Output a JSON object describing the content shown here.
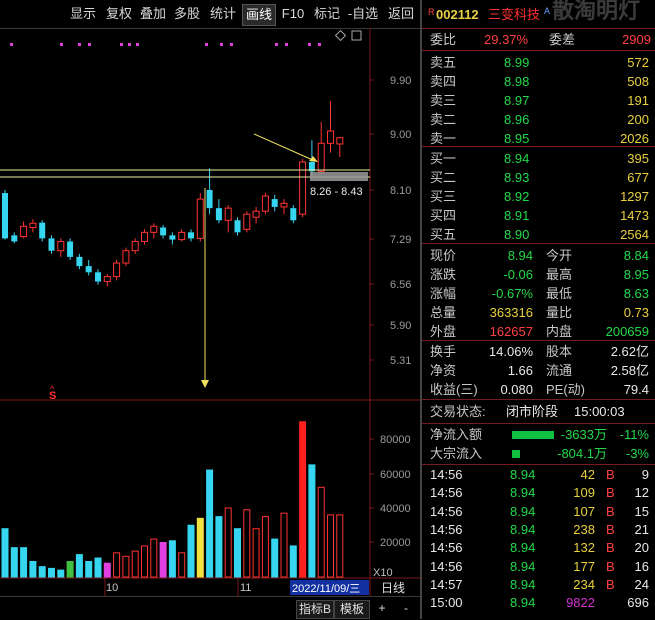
{
  "toolbar": {
    "items": [
      "显示",
      "复权",
      "叠加",
      "多股",
      "统计",
      "画线",
      "F10",
      "标记",
      "-自选",
      "返回"
    ],
    "active": "画线"
  },
  "chart": {
    "price_ticks": [
      "9.90",
      "9.00",
      "8.10",
      "7.29",
      "6.56",
      "5.90",
      "5.31"
    ],
    "range_label": "8.26 - 8.43",
    "volume_ticks": [
      "80000",
      "60000",
      "40000",
      "20000"
    ],
    "volume_unit": "X10",
    "date_labels": [
      "10",
      "11"
    ],
    "date_cursor": "2022/11/09/三",
    "period": "日线",
    "s_marker": "S"
  },
  "bottom": {
    "indicator_btn": "指标B",
    "template_btn": "模板",
    "plus_btn": "+",
    "minus_btn": "-"
  },
  "stock": {
    "flag": "R",
    "code": "002112",
    "name": "三变科技",
    "badge": "A",
    "watermark": "散淘明灯"
  },
  "order_ratio": {
    "label1": "委比",
    "value1": "29.37%",
    "label2": "委差",
    "value2": "2909"
  },
  "asks": [
    {
      "label": "卖五",
      "price": "8.99",
      "vol": "572"
    },
    {
      "label": "卖四",
      "price": "8.98",
      "vol": "508"
    },
    {
      "label": "卖三",
      "price": "8.97",
      "vol": "191"
    },
    {
      "label": "卖二",
      "price": "8.96",
      "vol": "200"
    },
    {
      "label": "卖一",
      "price": "8.95",
      "vol": "2026"
    }
  ],
  "bids": [
    {
      "label": "买一",
      "price": "8.94",
      "vol": "395"
    },
    {
      "label": "买二",
      "price": "8.93",
      "vol": "677"
    },
    {
      "label": "买三",
      "price": "8.92",
      "vol": "1297"
    },
    {
      "label": "买四",
      "price": "8.91",
      "vol": "1473"
    },
    {
      "label": "买五",
      "price": "8.90",
      "vol": "2564"
    }
  ],
  "quote": [
    {
      "l1": "现价",
      "v1": "8.94",
      "c1": "green",
      "l2": "今开",
      "v2": "8.84",
      "c2": "green"
    },
    {
      "l1": "涨跌",
      "v1": "-0.06",
      "c1": "green",
      "l2": "最高",
      "v2": "8.95",
      "c2": "green"
    },
    {
      "l1": "涨幅",
      "v1": "-0.67%",
      "c1": "green",
      "l2": "最低",
      "v2": "8.63",
      "c2": "green"
    },
    {
      "l1": "总量",
      "v1": "363316",
      "c1": "yellow",
      "l2": "量比",
      "v2": "0.73",
      "c2": "yellow"
    },
    {
      "l1": "外盘",
      "v1": "162657",
      "c1": "red",
      "l2": "内盘",
      "v2": "200659",
      "c2": "green"
    }
  ],
  "fundamentals": [
    {
      "l1": "换手",
      "v1": "14.06%",
      "l2": "股本",
      "v2": "2.62亿"
    },
    {
      "l1": "净资",
      "v1": "1.66",
      "l2": "流通",
      "v2": "2.58亿"
    },
    {
      "l1": "收益(三)",
      "v1": "0.080",
      "l2": "PE(动)",
      "v2": "79.4"
    }
  ],
  "trade_status": {
    "label": "交易状态:",
    "status": "闭市阶段",
    "time": "15:00:03"
  },
  "flow": [
    {
      "label": "净流入额",
      "value": "-3633万",
      "pct": "-11%",
      "bar": 0.75
    },
    {
      "label": "大宗流入",
      "value": "-804.1万",
      "pct": "-3%",
      "bar": 0.15
    }
  ],
  "ticks": [
    {
      "time": "14:56",
      "price": "8.94",
      "vol": "42",
      "bs": "B",
      "n": "9",
      "vc": "yellow"
    },
    {
      "time": "14:56",
      "price": "8.94",
      "vol": "109",
      "bs": "B",
      "n": "12",
      "vc": "yellow"
    },
    {
      "time": "14:56",
      "price": "8.94",
      "vol": "107",
      "bs": "B",
      "n": "15",
      "vc": "yellow"
    },
    {
      "time": "14:56",
      "price": "8.94",
      "vol": "238",
      "bs": "B",
      "n": "21",
      "vc": "yellow"
    },
    {
      "time": "14:56",
      "price": "8.94",
      "vol": "132",
      "bs": "B",
      "n": "20",
      "vc": "yellow"
    },
    {
      "time": "14:56",
      "price": "8.94",
      "vol": "177",
      "bs": "B",
      "n": "16",
      "vc": "yellow"
    },
    {
      "time": "14:57",
      "price": "8.94",
      "vol": "234",
      "bs": "B",
      "n": "24",
      "vc": "yellow"
    },
    {
      "time": "15:00",
      "price": "8.94",
      "vol": "9822",
      "bs": "",
      "n": "696",
      "vc": "magenta"
    }
  ],
  "chart_data": {
    "type": "candlestick",
    "price_axis": [
      "9.90",
      "9.00",
      "8.10",
      "7.29",
      "6.56",
      "5.90",
      "5.31"
    ],
    "horizontal_lines": [
      8.43,
      8.26
    ],
    "candles": [
      {
        "o": 7.3,
        "h": 8.1,
        "l": 7.28,
        "c": 8.05,
        "up": false
      },
      {
        "o": 7.35,
        "h": 7.4,
        "l": 7.22,
        "c": 7.25,
        "up": false
      },
      {
        "o": 7.33,
        "h": 7.58,
        "l": 7.3,
        "c": 7.5,
        "up": true
      },
      {
        "o": 7.48,
        "h": 7.62,
        "l": 7.4,
        "c": 7.55,
        "up": true
      },
      {
        "o": 7.56,
        "h": 7.6,
        "l": 7.25,
        "c": 7.3,
        "up": false
      },
      {
        "o": 7.3,
        "h": 7.35,
        "l": 7.05,
        "c": 7.1,
        "up": false
      },
      {
        "o": 7.1,
        "h": 7.3,
        "l": 7.0,
        "c": 7.25,
        "up": true
      },
      {
        "o": 7.25,
        "h": 7.3,
        "l": 6.95,
        "c": 7.0,
        "up": false
      },
      {
        "o": 7.0,
        "h": 7.05,
        "l": 6.8,
        "c": 6.85,
        "up": false
      },
      {
        "o": 6.85,
        "h": 6.95,
        "l": 6.7,
        "c": 6.75,
        "up": false
      },
      {
        "o": 6.75,
        "h": 6.8,
        "l": 6.55,
        "c": 6.6,
        "up": false
      },
      {
        "o": 6.6,
        "h": 6.72,
        "l": 6.52,
        "c": 6.68,
        "up": true
      },
      {
        "o": 6.68,
        "h": 6.95,
        "l": 6.62,
        "c": 6.9,
        "up": true
      },
      {
        "o": 6.9,
        "h": 7.15,
        "l": 6.85,
        "c": 7.1,
        "up": true
      },
      {
        "o": 7.1,
        "h": 7.3,
        "l": 7.05,
        "c": 7.25,
        "up": true
      },
      {
        "o": 7.25,
        "h": 7.45,
        "l": 7.2,
        "c": 7.4,
        "up": true
      },
      {
        "o": 7.4,
        "h": 7.55,
        "l": 7.3,
        "c": 7.5,
        "up": true
      },
      {
        "o": 7.48,
        "h": 7.52,
        "l": 7.3,
        "c": 7.35,
        "up": false
      },
      {
        "o": 7.35,
        "h": 7.4,
        "l": 7.2,
        "c": 7.28,
        "up": false
      },
      {
        "o": 7.28,
        "h": 7.45,
        "l": 7.25,
        "c": 7.4,
        "up": true
      },
      {
        "o": 7.4,
        "h": 7.45,
        "l": 7.25,
        "c": 7.3,
        "up": false
      },
      {
        "o": 7.3,
        "h": 8.05,
        "l": 7.25,
        "c": 7.95,
        "up": true
      },
      {
        "o": 8.1,
        "h": 8.45,
        "l": 7.7,
        "c": 7.8,
        "up": false
      },
      {
        "o": 7.8,
        "h": 7.95,
        "l": 7.55,
        "c": 7.6,
        "up": false
      },
      {
        "o": 7.6,
        "h": 7.85,
        "l": 7.4,
        "c": 7.8,
        "up": true
      },
      {
        "o": 7.6,
        "h": 7.65,
        "l": 7.35,
        "c": 7.4,
        "up": false
      },
      {
        "o": 7.45,
        "h": 7.75,
        "l": 7.4,
        "c": 7.7,
        "up": true
      },
      {
        "o": 7.65,
        "h": 7.82,
        "l": 7.55,
        "c": 7.75,
        "up": true
      },
      {
        "o": 7.75,
        "h": 8.05,
        "l": 7.7,
        "c": 8.0,
        "up": true
      },
      {
        "o": 7.95,
        "h": 8.02,
        "l": 7.75,
        "c": 7.82,
        "up": false
      },
      {
        "o": 7.82,
        "h": 7.95,
        "l": 7.7,
        "c": 7.88,
        "up": true
      },
      {
        "o": 7.8,
        "h": 7.85,
        "l": 7.55,
        "c": 7.6,
        "up": false
      },
      {
        "o": 7.7,
        "h": 8.6,
        "l": 7.65,
        "c": 8.55,
        "up": true
      },
      {
        "o": 8.55,
        "h": 8.9,
        "l": 8.3,
        "c": 8.4,
        "up": false
      },
      {
        "o": 8.4,
        "h": 9.2,
        "l": 8.38,
        "c": 8.85,
        "up": true
      },
      {
        "o": 8.85,
        "h": 9.55,
        "l": 8.7,
        "c": 9.05,
        "up": true
      },
      {
        "o": 8.84,
        "h": 8.95,
        "l": 8.63,
        "c": 8.94,
        "up": true
      }
    ],
    "volume_axis": [
      "80000",
      "60000",
      "40000",
      "20000"
    ],
    "volume": [
      28000,
      17000,
      17000,
      9000,
      6000,
      5000,
      4000,
      9000,
      13000,
      9000,
      11000,
      8000,
      14000,
      12000,
      15000,
      18000,
      22000,
      20000,
      21000,
      14000,
      30000,
      34000,
      62000,
      35000,
      40000,
      28000,
      39000,
      28000,
      35000,
      22000,
      37000,
      18000,
      90000,
      65000,
      52000,
      36000,
      36000
    ],
    "volume_up": [
      false,
      false,
      false,
      false,
      false,
      false,
      false,
      true,
      false,
      false,
      false,
      true,
      true,
      true,
      true,
      true,
      true,
      false,
      false,
      true,
      false,
      true,
      false,
      false,
      true,
      false,
      true,
      true,
      true,
      false,
      true,
      false,
      true,
      false,
      true,
      true,
      true
    ]
  }
}
